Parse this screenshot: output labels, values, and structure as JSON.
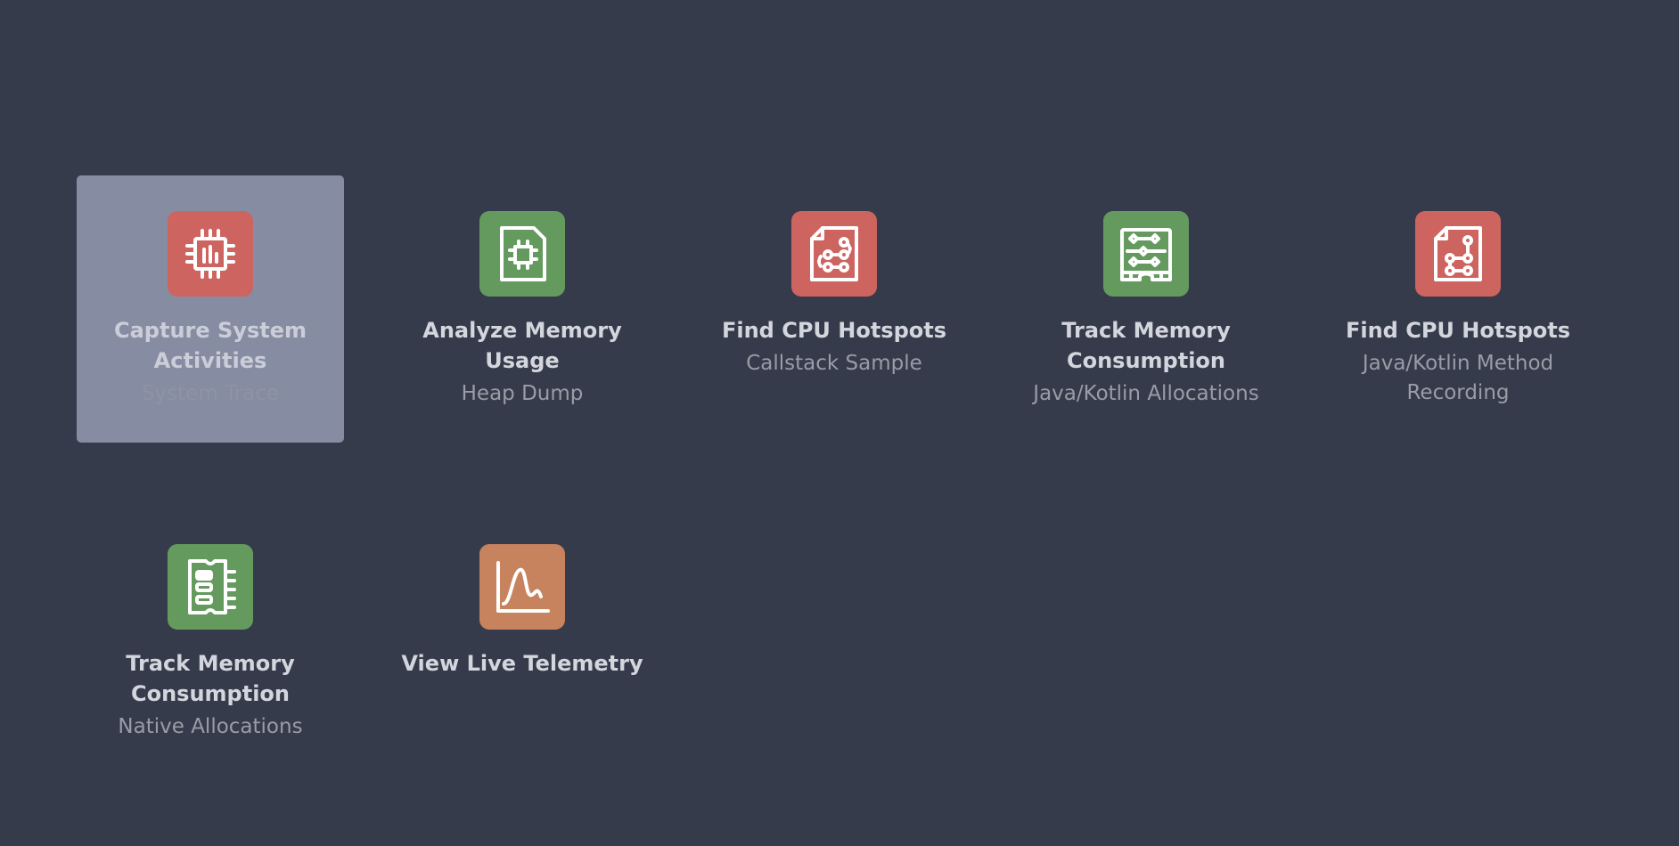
{
  "colors": {
    "background": "#363b4b",
    "selection": "#868ca2",
    "red_icon": "#cd6460",
    "green_icon": "#649a5e",
    "orange_icon": "#c7825e"
  },
  "tasks": [
    {
      "title": "Capture System Activities",
      "subtitle": "System Trace",
      "icon": "chip-activity-icon",
      "color": "red",
      "selected": true
    },
    {
      "title": "Analyze Memory Usage",
      "subtitle": "Heap Dump",
      "icon": "memory-chip-file-icon",
      "color": "green"
    },
    {
      "title": "Find CPU Hotspots",
      "subtitle": "Callstack Sample",
      "icon": "callstack-file-icon",
      "color": "red"
    },
    {
      "title": "Track Memory Consumption",
      "subtitle": "Java/Kotlin Allocations",
      "icon": "memory-allocations-icon",
      "color": "green"
    },
    {
      "title": "Find CPU Hotspots",
      "subtitle": "Java/Kotlin Method Recording",
      "icon": "method-trace-file-icon",
      "color": "red"
    },
    {
      "title": "Track Memory Consumption",
      "subtitle": "Native Allocations",
      "icon": "native-memory-icon",
      "color": "green"
    },
    {
      "title": "View Live Telemetry",
      "subtitle": "",
      "icon": "telemetry-chart-icon",
      "color": "orange"
    }
  ]
}
